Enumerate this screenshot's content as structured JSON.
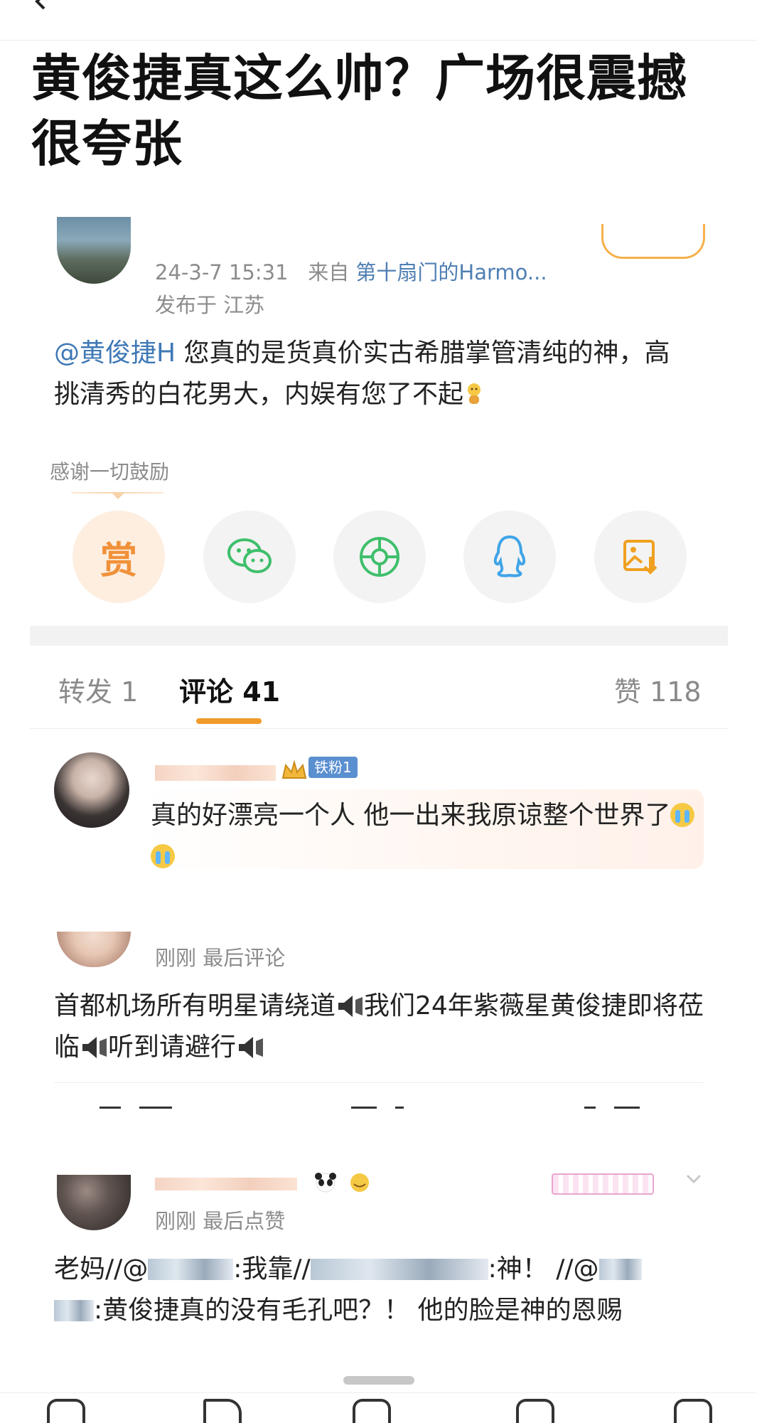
{
  "post": {
    "title": "黄俊捷真这么帅？广场很震撼很夸张",
    "date": "24-3-7 15:31",
    "from_label": "来自",
    "source": "第十扇门的Harmo...",
    "location": "发布于 江苏",
    "mention": "@黄俊捷H",
    "body": " 您真的是货真价实古希腊掌管清纯的神，高挑清秀的白花男大，内娱有您了不起"
  },
  "reward": {
    "hint": "感谢一切鼓励",
    "button_label": "赏",
    "share_targets": [
      "wechat-icon",
      "moments-icon",
      "qq-icon",
      "save-image-icon"
    ]
  },
  "tabs": {
    "repost": "转发 1",
    "comment": "评论 41",
    "like": "赞 118"
  },
  "comments": [
    {
      "badge": "铁粉1",
      "text": "真的好漂亮一个人 他一出来我原谅整个世界了"
    },
    {
      "meta": "刚刚 最后评论",
      "text_parts": [
        "首都机场所有明星请绕道",
        "我们24年紫薇星黄俊捷即将莅临",
        "听到请避行"
      ]
    },
    {
      "meta": "刚刚 最后点赞",
      "text_a": "老妈//@",
      "text_b": ":我靠//",
      "text_c": ":神！ //@",
      "text_d": ":黄俊捷真的没有毛孔吧？！ 他的脸是神的恩赐"
    }
  ],
  "colors": {
    "accent_orange": "#f09a2a",
    "link_blue": "#3f78b5",
    "meta_gray": "#8c8c8c"
  }
}
